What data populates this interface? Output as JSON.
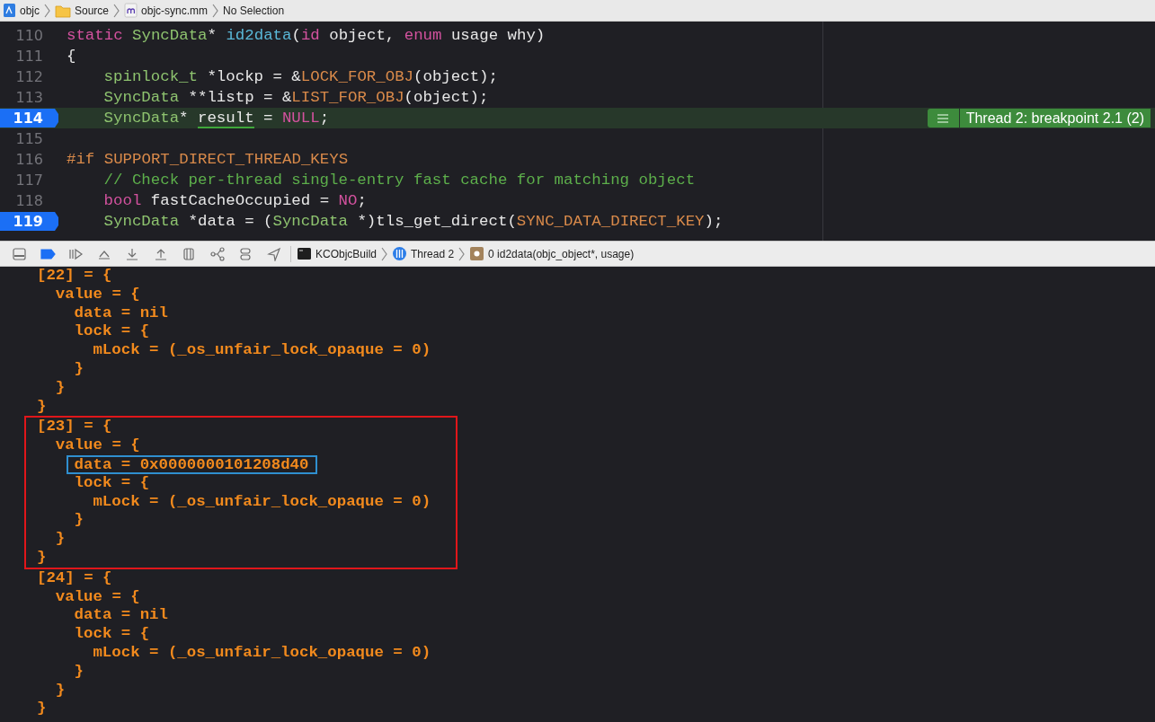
{
  "breadcrumb": [
    "objc",
    "Source",
    "objc-sync.mm",
    "No Selection"
  ],
  "editor": {
    "lines": [
      {
        "number": "110",
        "indented": false,
        "breakpoint": false,
        "current": false,
        "tokens": [
          {
            "kind": "keyword",
            "text": "static"
          },
          {
            "kind": "type",
            "text": " SyncData"
          },
          {
            "kind": "plain",
            "text": "* "
          },
          {
            "kind": "func",
            "text": "id2data"
          },
          {
            "kind": "plain",
            "text": "("
          },
          {
            "kind": "keyword",
            "text": "id"
          },
          {
            "kind": "plain",
            "text": " object, "
          },
          {
            "kind": "keyword",
            "text": "enum"
          },
          {
            "kind": "plain",
            "text": " usage why)"
          }
        ]
      },
      {
        "number": "111",
        "indented": false,
        "breakpoint": false,
        "current": false,
        "tokens": [
          {
            "kind": "plain",
            "text": "{"
          }
        ]
      },
      {
        "number": "112",
        "indented": true,
        "breakpoint": false,
        "current": false,
        "tokens": [
          {
            "kind": "type",
            "text": "spinlock_t"
          },
          {
            "kind": "plain",
            "text": " *lockp = &"
          },
          {
            "kind": "macro",
            "text": "LOCK_FOR_OBJ"
          },
          {
            "kind": "plain",
            "text": "(object);"
          }
        ]
      },
      {
        "number": "113",
        "indented": true,
        "breakpoint": false,
        "current": false,
        "tokens": [
          {
            "kind": "type",
            "text": "SyncData"
          },
          {
            "kind": "plain",
            "text": " **listp = &"
          },
          {
            "kind": "macro",
            "text": "LIST_FOR_OBJ"
          },
          {
            "kind": "plain",
            "text": "(object);"
          }
        ]
      },
      {
        "number": "114",
        "indented": true,
        "breakpoint": true,
        "current": true,
        "badge": "Thread 2: breakpoint 2.1 (2)",
        "tokens": [
          {
            "kind": "type",
            "text": "SyncData"
          },
          {
            "kind": "plain",
            "text": "* "
          },
          {
            "kind": "marked",
            "text": "result"
          },
          {
            "kind": "plain",
            "text": " = "
          },
          {
            "kind": "keyword",
            "text": "NULL"
          },
          {
            "kind": "plain",
            "text": ";"
          }
        ]
      },
      {
        "number": "115",
        "breakpoint": false,
        "current": false
      },
      {
        "number": "116",
        "indented": false,
        "breakpoint": false,
        "current": false,
        "tokens": [
          {
            "kind": "preproc",
            "text": "#if"
          },
          {
            "kind": "macro",
            "text": " SUPPORT_DIRECT_THREAD_KEYS"
          }
        ]
      },
      {
        "number": "117",
        "indented": true,
        "breakpoint": false,
        "current": false,
        "tokens": [
          {
            "kind": "comment",
            "text": "// Check per-thread single-entry fast cache for matching object"
          }
        ]
      },
      {
        "number": "118",
        "indented": true,
        "breakpoint": false,
        "current": false,
        "tokens": [
          {
            "kind": "keyword",
            "text": "bool"
          },
          {
            "kind": "plain",
            "text": " fastCacheOccupied = "
          },
          {
            "kind": "keyword",
            "text": "NO"
          },
          {
            "kind": "plain",
            "text": ";"
          }
        ]
      },
      {
        "number": "119",
        "indented": true,
        "breakpoint": true,
        "current": false,
        "tokens": [
          {
            "kind": "type",
            "text": "SyncData"
          },
          {
            "kind": "plain",
            "text": " *data = ("
          },
          {
            "kind": "type",
            "text": "SyncData"
          },
          {
            "kind": "plain",
            "text": " *)tls_get_direct("
          },
          {
            "kind": "macro",
            "text": "SYNC_DATA_DIRECT_KEY"
          },
          {
            "kind": "plain",
            "text": ");"
          }
        ]
      }
    ]
  },
  "debug_bar": {
    "breakpoints_enabled": true,
    "path": [
      "KCObjcBuild",
      "Thread 2",
      "0 id2data(objc_object*, usage)"
    ]
  },
  "console": {
    "entries": [
      {
        "text": "[22] = {",
        "outlined": false,
        "close": "}",
        "children": [
          {
            "text": "value = {",
            "outlined": false,
            "close": "}",
            "children": [
              {
                "text": "data = nil",
                "outlined": false
              },
              {
                "text": "lock = {",
                "outlined": false,
                "close": "}",
                "children": [
                  {
                    "text": "mLock = (_os_unfair_lock_opaque = 0)",
                    "outlined": false
                  }
                ]
              }
            ]
          }
        ]
      },
      {
        "text": "[23] = {",
        "outlined": true,
        "close": "}",
        "children": [
          {
            "text": "value = {",
            "outlined": false,
            "close": "}",
            "children": [
              {
                "text": "data = 0x0000000101208d40",
                "outlined": true
              },
              {
                "text": "lock = {",
                "outlined": false,
                "close": "}",
                "children": [
                  {
                    "text": "mLock = (_os_unfair_lock_opaque = 0)",
                    "outlined": false
                  }
                ]
              }
            ]
          }
        ]
      },
      {
        "text": "[24] = {",
        "outlined": false,
        "close": "}",
        "children": [
          {
            "text": "value = {",
            "outlined": false,
            "close": "}",
            "children": [
              {
                "text": "data = nil",
                "outlined": false
              },
              {
                "text": "lock = {",
                "outlined": false,
                "close": "}",
                "children": [
                  {
                    "text": "mLock = (_os_unfair_lock_opaque = 0)",
                    "outlined": false
                  }
                ]
              }
            ]
          }
        ]
      }
    ]
  }
}
